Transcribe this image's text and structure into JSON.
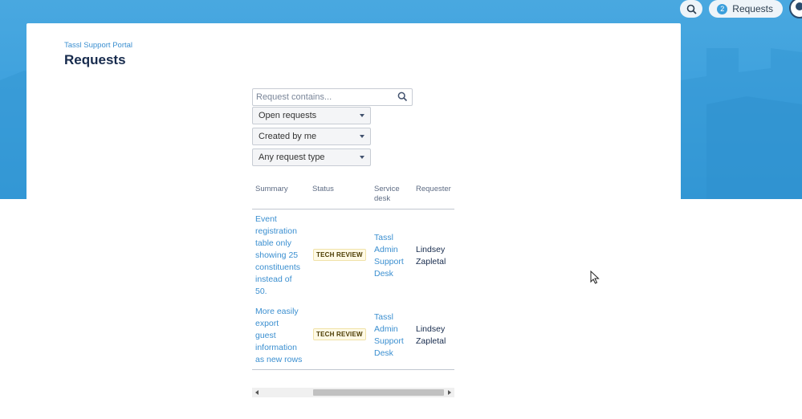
{
  "header": {
    "requests_label": "Requests",
    "requests_count": "2"
  },
  "breadcrumb": "Tassl Support Portal",
  "page_title": "Requests",
  "search": {
    "placeholder": "Request contains..."
  },
  "filters": [
    {
      "label": "Open requests"
    },
    {
      "label": "Created by me"
    },
    {
      "label": "Any request type"
    }
  ],
  "table": {
    "columns": {
      "summary": "Summary",
      "status": "Status",
      "service_desk_line1": "Service",
      "service_desk_line2": "desk",
      "requester": "Requester"
    },
    "rows": [
      {
        "summary": [
          "Event",
          "registration",
          "table only",
          "showing 25",
          "constituents",
          "instead of",
          "50."
        ],
        "status": "TECH REVIEW",
        "service_desk": [
          "Tassl",
          "Admin",
          "Support",
          "Desk"
        ],
        "requester": [
          "Lindsey",
          "Zapletal"
        ]
      },
      {
        "summary": [
          "More easily",
          "export",
          "guest",
          "information",
          "as new rows"
        ],
        "status": "TECH REVIEW",
        "service_desk": [
          "Tassl",
          "Admin",
          "Support",
          "Desk"
        ],
        "requester": [
          "Lindsey",
          "Zapletal"
        ]
      }
    ]
  },
  "colors": {
    "hero": "#3b9fdc",
    "link": "#3b8fd0",
    "title": "#172b4d"
  }
}
